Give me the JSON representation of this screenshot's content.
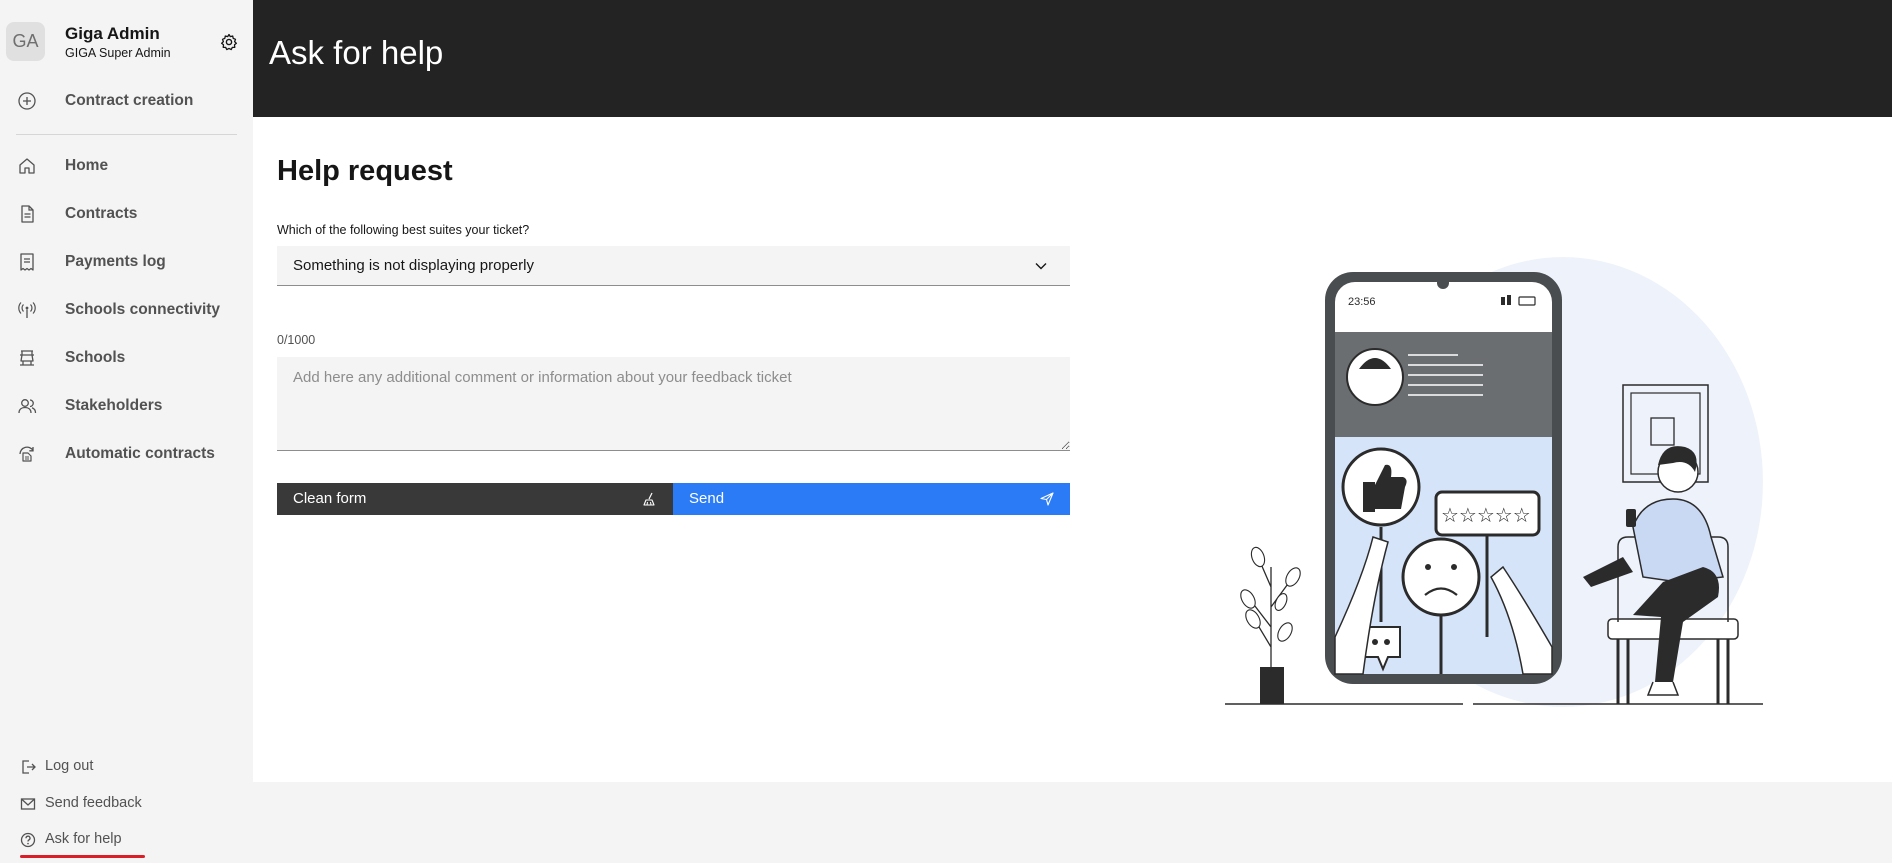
{
  "profile": {
    "initials": "GA",
    "name": "Giga Admin",
    "role": "GIGA Super Admin"
  },
  "sidebar": {
    "items": [
      {
        "label": "Contract creation",
        "icon": "add-circle-icon"
      },
      {
        "label": "Home",
        "icon": "home-icon"
      },
      {
        "label": "Contracts",
        "icon": "document-icon"
      },
      {
        "label": "Payments log",
        "icon": "receipt-icon"
      },
      {
        "label": "Schools connectivity",
        "icon": "signal-icon"
      },
      {
        "label": "Schools",
        "icon": "school-icon"
      },
      {
        "label": "Stakeholders",
        "icon": "group-icon"
      },
      {
        "label": "Automatic contracts",
        "icon": "automation-icon"
      }
    ],
    "bottom_items": [
      {
        "label": "Log out",
        "icon": "logout-icon"
      },
      {
        "label": "Send feedback",
        "icon": "feedback-icon"
      },
      {
        "label": "Ask for help",
        "icon": "help-icon"
      }
    ]
  },
  "header": {
    "title": "Ask for help"
  },
  "form": {
    "title": "Help request",
    "question_label": "Which of the following best suites your ticket?",
    "selected_option": "Something is not displaying properly",
    "counter": "0/1000",
    "comment_placeholder": "Add here any additional comment or information about your feedback ticket",
    "comment_value": "",
    "clean_label": "Clean form",
    "send_label": "Send"
  },
  "illustration": {
    "phone_time": "23:56"
  },
  "colors": {
    "header_bg": "#232323",
    "send_button": "#2a7bf5",
    "clean_button": "#393939",
    "active_indicator": "#da1e28"
  }
}
